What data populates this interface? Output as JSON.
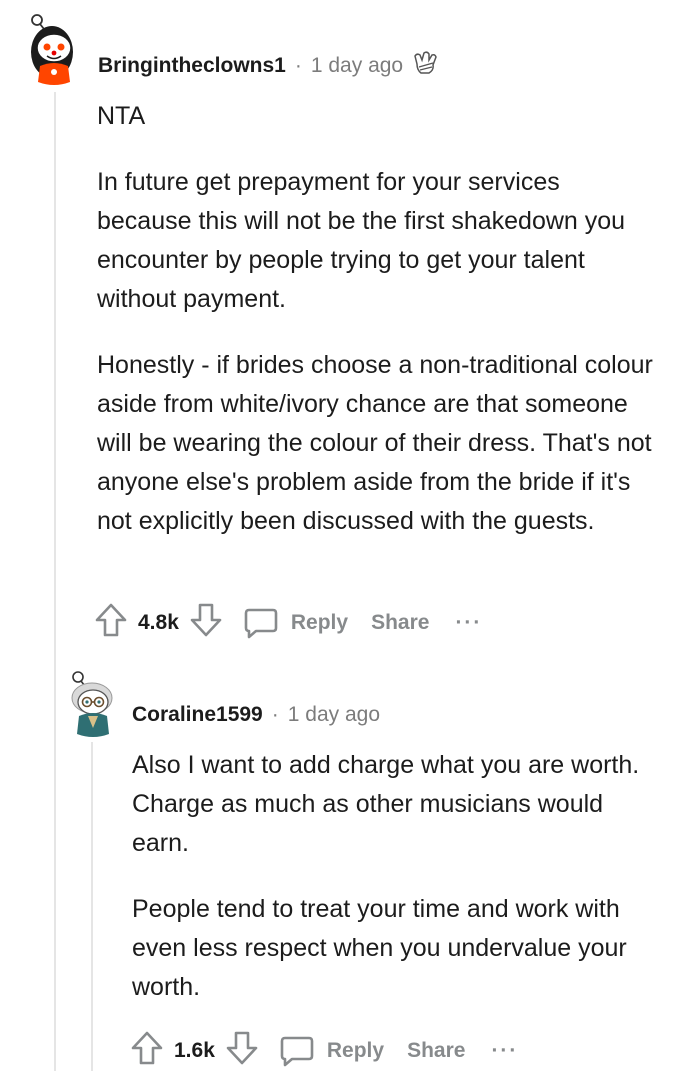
{
  "comments": [
    {
      "username": "Bringintheclowns1",
      "separator": "·",
      "time": "1 day ago",
      "paragraphs": [
        "NTA",
        "In future get prepayment for your services because this will not be the first shakedown you encounter by people trying to get your talent without payment.",
        "Honestly - if brides choose a non-traditional colour aside from white/ivory chance are that someone will be wearing the colour of their dress. That's not anyone else's problem aside from the bride if it's not explicitly been discussed with the guests."
      ],
      "score": "4.8k",
      "reply_label": "Reply",
      "share_label": "Share",
      "more_label": "···"
    },
    {
      "username": "Coraline1599",
      "separator": "·",
      "time": "1 day ago",
      "paragraphs": [
        "Also I want to add charge what you are worth. Charge as much as other musicians would earn.",
        "People tend to treat your time and work with even less respect when you undervalue your worth."
      ],
      "score": "1.6k",
      "reply_label": "Reply",
      "share_label": "Share",
      "more_label": "···"
    }
  ],
  "colors": {
    "text": "#1c1c1c",
    "meta": "#7c7c7c",
    "action": "#878a8c",
    "thread_line": "#e5e5e5",
    "avatar1_accent": "#ff4500",
    "avatar2_accent": "#2f6f73"
  },
  "icons": {
    "upvote": "upvote-arrow-icon",
    "downvote": "downvote-arrow-icon",
    "reply": "speech-bubble-icon",
    "award": "award-icon",
    "more": "more-dots-icon"
  }
}
